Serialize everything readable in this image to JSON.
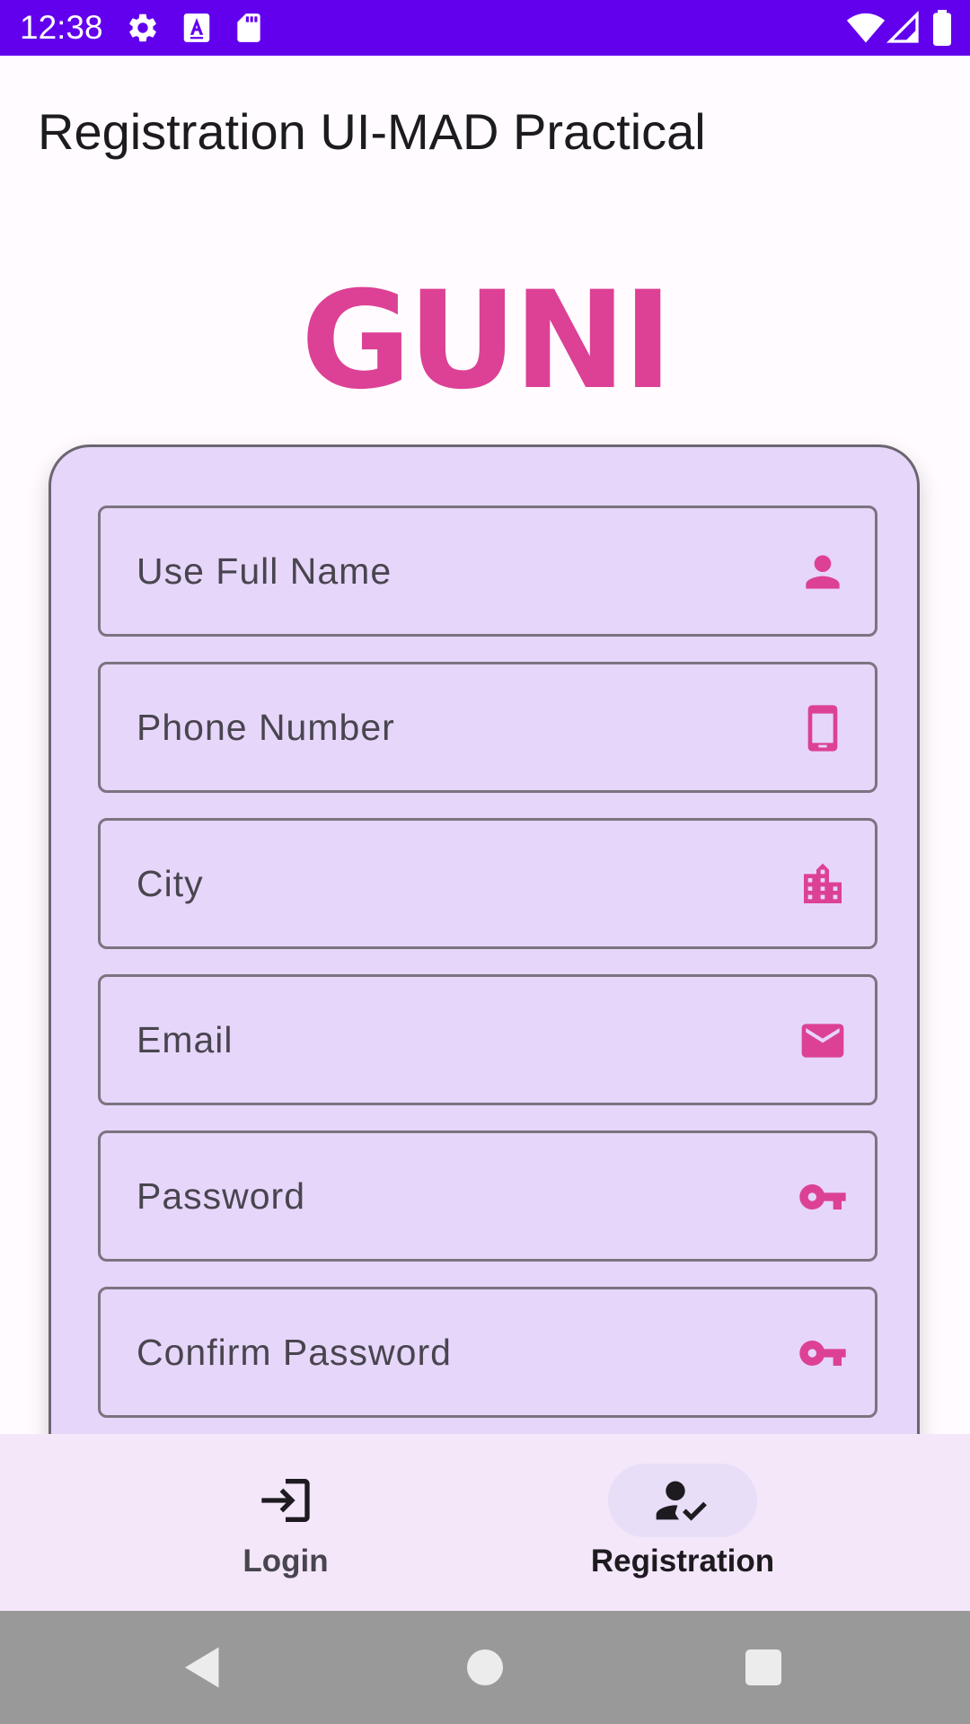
{
  "status_bar": {
    "time": "12:38",
    "left_icons": [
      "gear-icon",
      "a-badge-icon",
      "sd-card-icon"
    ],
    "right_icons": [
      "wifi-icon",
      "signal-icon",
      "battery-icon"
    ],
    "background": "#6200ee"
  },
  "app_bar": {
    "title": "Registration UI-MAD Practical"
  },
  "logo": {
    "text": "GUNI",
    "color": "#dc4195"
  },
  "form": {
    "fields": [
      {
        "placeholder": "Use Full Name",
        "icon": "person-icon"
      },
      {
        "placeholder": "Phone Number",
        "icon": "smartphone-icon"
      },
      {
        "placeholder": "City",
        "icon": "city-building-icon"
      },
      {
        "placeholder": "Email",
        "icon": "mail-icon"
      },
      {
        "placeholder": "Password",
        "icon": "key-icon"
      },
      {
        "placeholder": "Confirm Password",
        "icon": "key-icon"
      }
    ],
    "icon_color": "#dc4195",
    "card_color": "#e6d6fa"
  },
  "bottom_nav": {
    "items": [
      {
        "label": "Login",
        "icon": "login-icon",
        "selected": false
      },
      {
        "label": "Registration",
        "icon": "how-to-reg-icon",
        "selected": true
      }
    ]
  },
  "system_nav": {
    "buttons": [
      "back-icon",
      "home-icon",
      "recents-icon"
    ]
  }
}
